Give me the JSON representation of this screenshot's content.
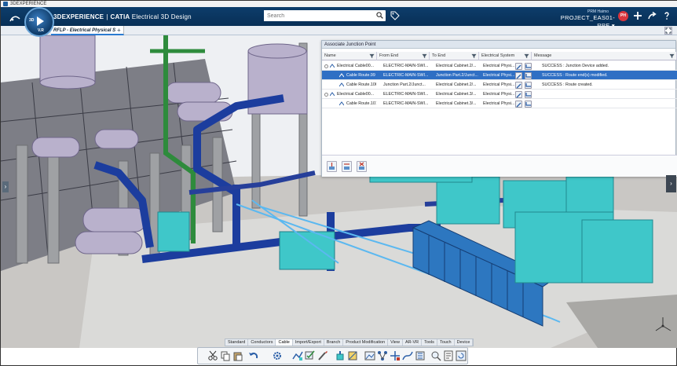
{
  "window": {
    "title": "3DEXPERIENCE"
  },
  "header": {
    "brand_3d": "3D",
    "brand_experience": "EXPERIENCE",
    "brand_app": "CATIA",
    "brand_module": "Electrical 3D Design",
    "compass_v": "V.R",
    "search_placeholder": "Search",
    "user": "PRM  Haimo",
    "project": "PROJECT_EAS01-RPE",
    "avatar_initials": "PH"
  },
  "tabs": {
    "active": "RFLP - Electrical Physical S",
    "add": "+"
  },
  "panel": {
    "title": "Associate Junction Point",
    "columns": [
      "Name",
      "From End",
      "To End",
      "Electrical System",
      "Message"
    ],
    "rows": [
      {
        "name": "Electrical Cable00...",
        "from": "ELECTRIC-MAIN-SWI...",
        "to": "Electrical Cabinet.2/...",
        "system": "Electrical Physi...",
        "message": "SUCCESS : Junction Device added.",
        "level": 0,
        "selected": false
      },
      {
        "name": "Cable Route.99",
        "from": "ELECTRIC-MAIN-SWI...",
        "to": "Junction Part.2/Junct...",
        "system": "Electrical Physi...",
        "message": "SUCCESS : Route end(s) modified.",
        "level": 1,
        "selected": true
      },
      {
        "name": "Cable Route.106",
        "from": "Junction Part.2/Junct...",
        "to": "Electrical Cabinet.2/...",
        "system": "Electrical Physi...",
        "message": "SUCCESS : Route created.",
        "level": 1,
        "selected": false
      },
      {
        "name": "Electrical Cable00...",
        "from": "ELECTRIC-MAIN-SWI...",
        "to": "Electrical Cabinet.3/...",
        "system": "Electrical Physi...",
        "message": "",
        "level": 0,
        "selected": false
      },
      {
        "name": "Cable Route.101",
        "from": "ELECTRIC-MAIN-SWI...",
        "to": "Electrical Cabinet.3/...",
        "system": "Electrical Physi...",
        "message": "",
        "level": 1,
        "selected": false
      }
    ]
  },
  "action_bar": {
    "tabs": [
      "Standard",
      "Conductors",
      "Cable",
      "Import/Export",
      "Branch",
      "Product Modification",
      "View",
      "AR-VR",
      "Tools",
      "Touch",
      "Device"
    ],
    "active_tab": "Cable"
  },
  "colors": {
    "accent": "#2f6fc4",
    "header": "#0d3d6b",
    "equipment": "#3fc7c9",
    "pipe": "#1c3d9e",
    "cable": "#5bb8f0"
  }
}
